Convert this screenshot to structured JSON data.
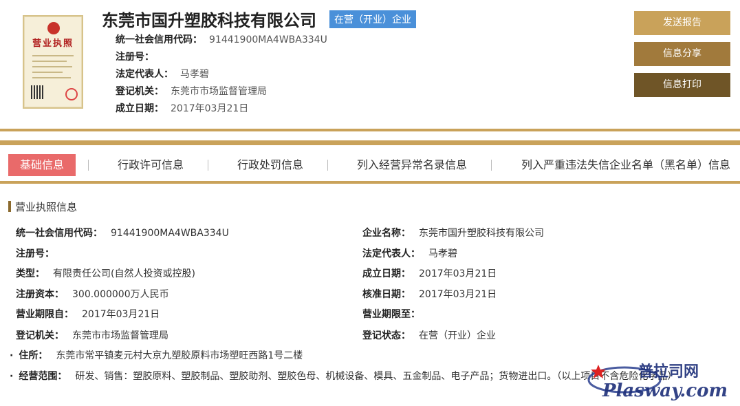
{
  "header": {
    "license_title": "营业执照",
    "company_name": "东莞市国升塑胶科技有限公司",
    "status_badge": "在营（开业）企业",
    "fields": [
      {
        "label": "统一社会信用代码：",
        "value": "91441900MA4WBA334U"
      },
      {
        "label": "注册号：",
        "value": ""
      },
      {
        "label": "法定代表人：",
        "value": "马孝碧"
      },
      {
        "label": "登记机关：",
        "value": "东莞市市场监督管理局"
      },
      {
        "label": "成立日期：",
        "value": "2017年03月21日"
      }
    ],
    "buttons": {
      "report": "发送报告",
      "share": "信息分享",
      "print": "信息打印"
    }
  },
  "tabs": [
    {
      "label": "基础信息",
      "active": true
    },
    {
      "label": "行政许可信息",
      "active": false
    },
    {
      "label": "行政处罚信息",
      "active": false
    },
    {
      "label": "列入经营异常名录信息",
      "active": false
    },
    {
      "label": "列入严重违法失信企业名单（黑名单）信息",
      "active": false
    }
  ],
  "section": {
    "title": "营业执照信息",
    "left": [
      {
        "label": "统一社会信用代码：",
        "value": "91441900MA4WBA334U"
      },
      {
        "label": "注册号：",
        "value": ""
      },
      {
        "label": "类型：",
        "value": "有限责任公司(自然人投资或控股)"
      },
      {
        "label": "注册资本：",
        "value": "300.000000万人民币"
      },
      {
        "label": "营业期限自：",
        "value": "2017年03月21日"
      },
      {
        "label": "登记机关：",
        "value": "东莞市市场监督管理局"
      }
    ],
    "right": [
      {
        "label": "企业名称：",
        "value": "东莞市国升塑胶科技有限公司"
      },
      {
        "label": "法定代表人：",
        "value": "马孝碧"
      },
      {
        "label": "成立日期：",
        "value": "2017年03月21日"
      },
      {
        "label": "核准日期：",
        "value": "2017年03月21日"
      },
      {
        "label": "营业期限至：",
        "value": ""
      },
      {
        "label": "登记状态：",
        "value": "在营（开业）企业"
      }
    ],
    "address": {
      "label": "住所：",
      "value": "东莞市常平镇麦元村大京九塑胶原料市场塑旺西路1号二楼"
    },
    "scope": {
      "label": "经营范围：",
      "value": "研发、销售：塑胶原料、塑胶制品、塑胶助剂、塑胶色母、机械设备、模具、五金制品、电子产品；货物进出口。（以上项目不含危险化学品）"
    }
  },
  "watermark": {
    "cn": "普拉司网",
    "en": "Plasway.com"
  },
  "colors": {
    "gold": "#c9a25a",
    "tab_active": "#e96a6a",
    "badge": "#4a90d9"
  }
}
